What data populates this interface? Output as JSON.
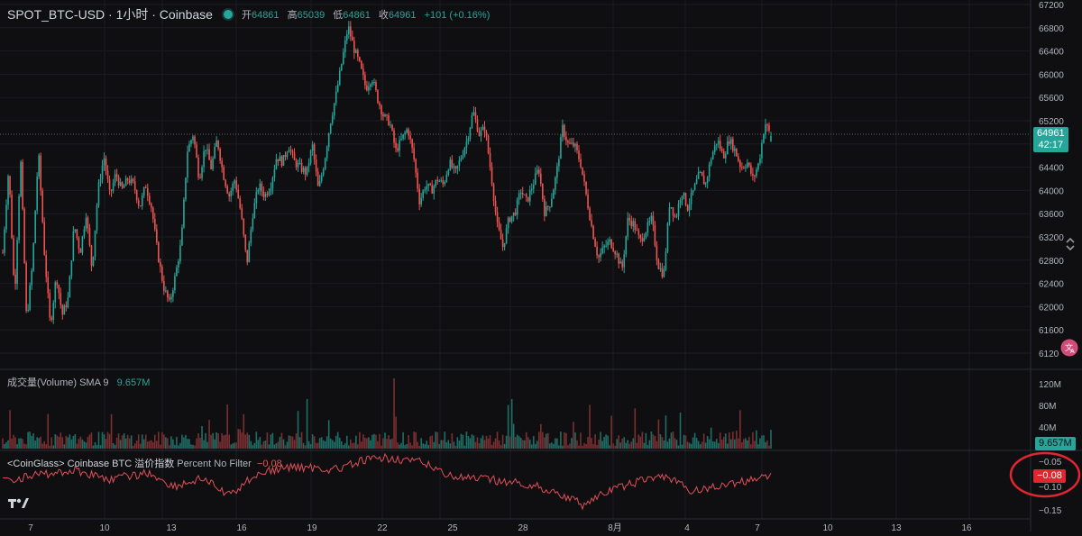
{
  "legend": {
    "symbol": "SPOT_BTC-USD · 1小时 · Coinbase",
    "open_label": "开",
    "open": "64861",
    "high_label": "高",
    "high": "65039",
    "low_label": "低",
    "low": "64861",
    "close_label": "收",
    "close": "64961",
    "change": "+101 (+0.16%)"
  },
  "price_axis": {
    "ticks": [
      "67200",
      "66800",
      "66400",
      "66000",
      "65600",
      "65200",
      "64800",
      "64400",
      "64000",
      "63600",
      "63200",
      "62800",
      "62400",
      "62000",
      "61600",
      "6120"
    ],
    "last_price": "64961",
    "countdown": "42:17"
  },
  "volume_pane": {
    "title": "成交量(Volume)",
    "sma_label": "SMA 9",
    "sma_value": "9.657M",
    "ticks": [
      "120M",
      "80M",
      "40M"
    ],
    "last_value": "9.657M"
  },
  "premium_pane": {
    "title": "<CoinGlass> Coinbase BTC 溢价指数",
    "params": "Percent No Filter",
    "value": "−0.08",
    "ticks": [
      "−0.05",
      "−0.10",
      "−0.15"
    ],
    "current": "−0.08"
  },
  "time_axis": {
    "labels": [
      "7",
      "10",
      "13",
      "16",
      "19",
      "22",
      "25",
      "28",
      "8月",
      "4",
      "7",
      "10",
      "13",
      "16"
    ]
  },
  "colors": {
    "up": "#26a69a",
    "down": "#ef5350",
    "background": "#0f0f12",
    "annotation": "#e0262f"
  },
  "chart_data": {
    "type": "candlestick",
    "interval": "1h",
    "ylim": [
      61000,
      67300
    ],
    "close_path": [
      [
        0,
        62900
      ],
      [
        1,
        64400
      ],
      [
        2,
        62100
      ],
      [
        3,
        64600
      ],
      [
        4,
        61700
      ],
      [
        5,
        62700
      ],
      [
        6,
        64700
      ],
      [
        7,
        62900
      ],
      [
        8,
        61600
      ],
      [
        9,
        62500
      ],
      [
        10,
        61800
      ],
      [
        11,
        62100
      ],
      [
        12,
        63400
      ],
      [
        13,
        62900
      ],
      [
        14,
        63600
      ],
      [
        15,
        62600
      ],
      [
        16,
        64000
      ],
      [
        17,
        64600
      ],
      [
        18,
        63900
      ],
      [
        19,
        64300
      ],
      [
        20,
        64000
      ],
      [
        21,
        64200
      ],
      [
        22,
        64100
      ],
      [
        23,
        63700
      ],
      [
        24,
        64100
      ],
      [
        25,
        63700
      ],
      [
        26,
        62900
      ],
      [
        27,
        62300
      ],
      [
        28,
        62000
      ],
      [
        29,
        62500
      ],
      [
        30,
        63100
      ],
      [
        31,
        64700
      ],
      [
        32,
        65000
      ],
      [
        33,
        64200
      ],
      [
        34,
        64800
      ],
      [
        35,
        64400
      ],
      [
        36,
        64900
      ],
      [
        37,
        64300
      ],
      [
        38,
        63900
      ],
      [
        39,
        64200
      ],
      [
        40,
        63600
      ],
      [
        41,
        62700
      ],
      [
        42,
        63600
      ],
      [
        43,
        64100
      ],
      [
        44,
        63900
      ],
      [
        45,
        64100
      ],
      [
        46,
        64600
      ],
      [
        47,
        64500
      ],
      [
        48,
        64800
      ],
      [
        49,
        64500
      ],
      [
        50,
        64400
      ],
      [
        51,
        64300
      ],
      [
        52,
        64800
      ],
      [
        53,
        64000
      ],
      [
        54,
        64500
      ],
      [
        55,
        65200
      ],
      [
        56,
        65700
      ],
      [
        57,
        66300
      ],
      [
        58,
        66900
      ],
      [
        59,
        66500
      ],
      [
        60,
        66200
      ],
      [
        61,
        65800
      ],
      [
        62,
        66000
      ],
      [
        63,
        65600
      ],
      [
        64,
        65300
      ],
      [
        65,
        65200
      ],
      [
        66,
        64700
      ],
      [
        67,
        64900
      ],
      [
        68,
        65100
      ],
      [
        69,
        64600
      ],
      [
        70,
        63800
      ],
      [
        71,
        64100
      ],
      [
        72,
        64000
      ],
      [
        73,
        64200
      ],
      [
        74,
        64100
      ],
      [
        75,
        64500
      ],
      [
        76,
        64300
      ],
      [
        77,
        64600
      ],
      [
        78,
        64900
      ],
      [
        79,
        65400
      ],
      [
        80,
        65000
      ],
      [
        81,
        65100
      ],
      [
        82,
        64300
      ],
      [
        83,
        63400
      ],
      [
        84,
        63000
      ],
      [
        85,
        63500
      ],
      [
        86,
        63600
      ],
      [
        87,
        64000
      ],
      [
        88,
        63800
      ],
      [
        89,
        64100
      ],
      [
        90,
        64400
      ],
      [
        91,
        63600
      ],
      [
        92,
        63800
      ],
      [
        93,
        64300
      ],
      [
        94,
        65100
      ],
      [
        95,
        64800
      ],
      [
        96,
        64800
      ],
      [
        97,
        64500
      ],
      [
        98,
        63900
      ],
      [
        99,
        63300
      ],
      [
        100,
        62800
      ],
      [
        101,
        63000
      ],
      [
        102,
        63100
      ],
      [
        103,
        62900
      ],
      [
        104,
        62600
      ],
      [
        105,
        63500
      ],
      [
        106,
        63400
      ],
      [
        107,
        63100
      ],
      [
        108,
        63300
      ],
      [
        109,
        63500
      ],
      [
        110,
        62700
      ],
      [
        111,
        62500
      ],
      [
        112,
        63800
      ],
      [
        113,
        63500
      ],
      [
        114,
        64000
      ],
      [
        115,
        63700
      ],
      [
        116,
        64000
      ],
      [
        117,
        64300
      ],
      [
        118,
        64100
      ],
      [
        119,
        64600
      ],
      [
        120,
        64900
      ],
      [
        121,
        64600
      ],
      [
        122,
        64900
      ],
      [
        123,
        64700
      ],
      [
        124,
        64400
      ],
      [
        125,
        64500
      ],
      [
        126,
        64200
      ],
      [
        127,
        64500
      ],
      [
        128,
        65200
      ],
      [
        129,
        64961
      ]
    ]
  }
}
